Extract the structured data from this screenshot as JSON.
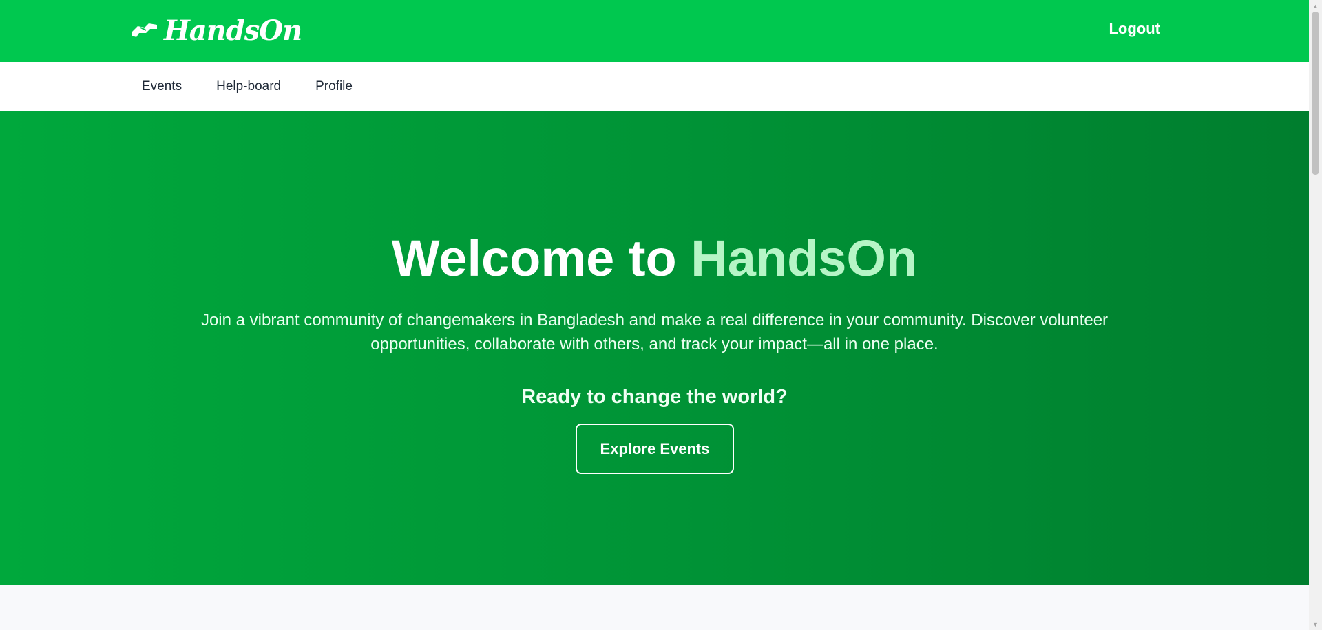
{
  "header": {
    "brand": "HandsOn",
    "logo_icon": "handshake-icon",
    "logout_label": "Logout",
    "background_color": "#00c84f"
  },
  "nav": {
    "items": [
      {
        "label": "Events"
      },
      {
        "label": "Help-board"
      },
      {
        "label": "Profile"
      }
    ]
  },
  "hero": {
    "title_prefix": "Welcome to ",
    "title_accent": "HandsOn",
    "description": "Join a vibrant community of changemakers in Bangladesh and make a real difference in your community. Discover volunteer opportunities, collaborate with others, and track your impact—all in one place.",
    "cta_text": "Ready to change the world?",
    "button_label": "Explore Events",
    "gradient_start": "#00a83c",
    "gradient_end": "#007e2e",
    "accent_color": "#b6f5c6"
  }
}
